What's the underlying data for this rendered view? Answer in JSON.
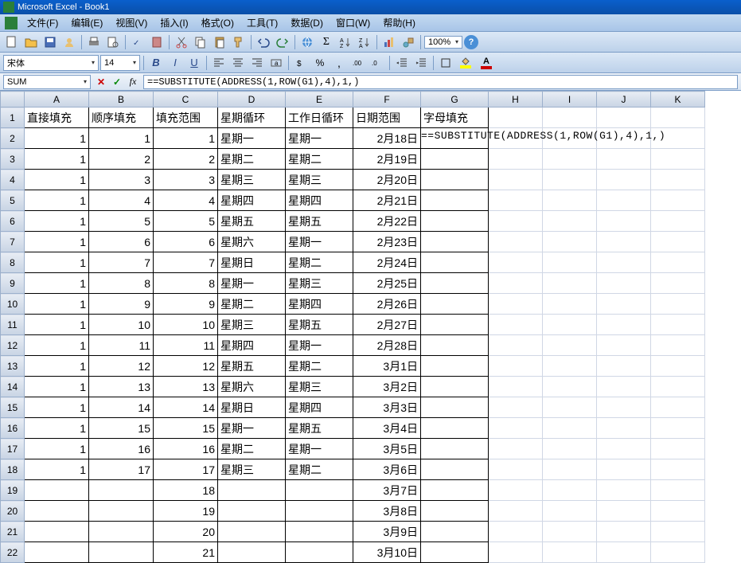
{
  "title": "Microsoft Excel - Book1",
  "menus": [
    "文件(F)",
    "编辑(E)",
    "视图(V)",
    "插入(I)",
    "格式(O)",
    "工具(T)",
    "数据(D)",
    "窗口(W)",
    "帮助(H)"
  ],
  "zoom": "100%",
  "font_name": "宋体",
  "font_size": "14",
  "namebox": "SUM",
  "formula": "==SUBSTITUTE(ADDRESS(1,ROW(G1),4),1,)",
  "columns": [
    "A",
    "B",
    "C",
    "D",
    "E",
    "F",
    "G",
    "H",
    "I",
    "J",
    "K"
  ],
  "headers": {
    "A": "直接填充",
    "B": "顺序填充",
    "C": "填充范围",
    "D": "星期循环",
    "E": "工作日循环",
    "F": "日期范围",
    "G": "字母填充"
  },
  "editing_cell_text": "==SUBSTITUTE(ADDRESS(1,ROW(G1),4),1,)",
  "rows": [
    {
      "r": "1",
      "A": "直接填充",
      "B": "顺序填充",
      "C": "填充范围",
      "D": "星期循环",
      "E": "工作日循环",
      "F": "日期范围",
      "G": "字母填充"
    },
    {
      "r": "2",
      "A": "1",
      "B": "1",
      "C": "1",
      "D": "星期一",
      "E": "星期一",
      "F": "2月18日",
      "G": "__EDITING__"
    },
    {
      "r": "3",
      "A": "1",
      "B": "2",
      "C": "2",
      "D": "星期二",
      "E": "星期二",
      "F": "2月19日",
      "G": ""
    },
    {
      "r": "4",
      "A": "1",
      "B": "3",
      "C": "3",
      "D": "星期三",
      "E": "星期三",
      "F": "2月20日",
      "G": ""
    },
    {
      "r": "5",
      "A": "1",
      "B": "4",
      "C": "4",
      "D": "星期四",
      "E": "星期四",
      "F": "2月21日",
      "G": ""
    },
    {
      "r": "6",
      "A": "1",
      "B": "5",
      "C": "5",
      "D": "星期五",
      "E": "星期五",
      "F": "2月22日",
      "G": ""
    },
    {
      "r": "7",
      "A": "1",
      "B": "6",
      "C": "6",
      "D": "星期六",
      "E": "星期一",
      "F": "2月23日",
      "G": ""
    },
    {
      "r": "8",
      "A": "1",
      "B": "7",
      "C": "7",
      "D": "星期日",
      "E": "星期二",
      "F": "2月24日",
      "G": ""
    },
    {
      "r": "9",
      "A": "1",
      "B": "8",
      "C": "8",
      "D": "星期一",
      "E": "星期三",
      "F": "2月25日",
      "G": ""
    },
    {
      "r": "10",
      "A": "1",
      "B": "9",
      "C": "9",
      "D": "星期二",
      "E": "星期四",
      "F": "2月26日",
      "G": ""
    },
    {
      "r": "11",
      "A": "1",
      "B": "10",
      "C": "10",
      "D": "星期三",
      "E": "星期五",
      "F": "2月27日",
      "G": ""
    },
    {
      "r": "12",
      "A": "1",
      "B": "11",
      "C": "11",
      "D": "星期四",
      "E": "星期一",
      "F": "2月28日",
      "G": ""
    },
    {
      "r": "13",
      "A": "1",
      "B": "12",
      "C": "12",
      "D": "星期五",
      "E": "星期二",
      "F": "3月1日",
      "G": ""
    },
    {
      "r": "14",
      "A": "1",
      "B": "13",
      "C": "13",
      "D": "星期六",
      "E": "星期三",
      "F": "3月2日",
      "G": ""
    },
    {
      "r": "15",
      "A": "1",
      "B": "14",
      "C": "14",
      "D": "星期日",
      "E": "星期四",
      "F": "3月3日",
      "G": ""
    },
    {
      "r": "16",
      "A": "1",
      "B": "15",
      "C": "15",
      "D": "星期一",
      "E": "星期五",
      "F": "3月4日",
      "G": ""
    },
    {
      "r": "17",
      "A": "1",
      "B": "16",
      "C": "16",
      "D": "星期二",
      "E": "星期一",
      "F": "3月5日",
      "G": ""
    },
    {
      "r": "18",
      "A": "1",
      "B": "17",
      "C": "17",
      "D": "星期三",
      "E": "星期二",
      "F": "3月6日",
      "G": ""
    },
    {
      "r": "19",
      "A": "",
      "B": "",
      "C": "18",
      "D": "",
      "E": "",
      "F": "3月7日",
      "G": ""
    },
    {
      "r": "20",
      "A": "",
      "B": "",
      "C": "19",
      "D": "",
      "E": "",
      "F": "3月8日",
      "G": ""
    },
    {
      "r": "21",
      "A": "",
      "B": "",
      "C": "20",
      "D": "",
      "E": "",
      "F": "3月9日",
      "G": ""
    },
    {
      "r": "22",
      "A": "",
      "B": "",
      "C": "21",
      "D": "",
      "E": "",
      "F": "3月10日",
      "G": ""
    }
  ]
}
